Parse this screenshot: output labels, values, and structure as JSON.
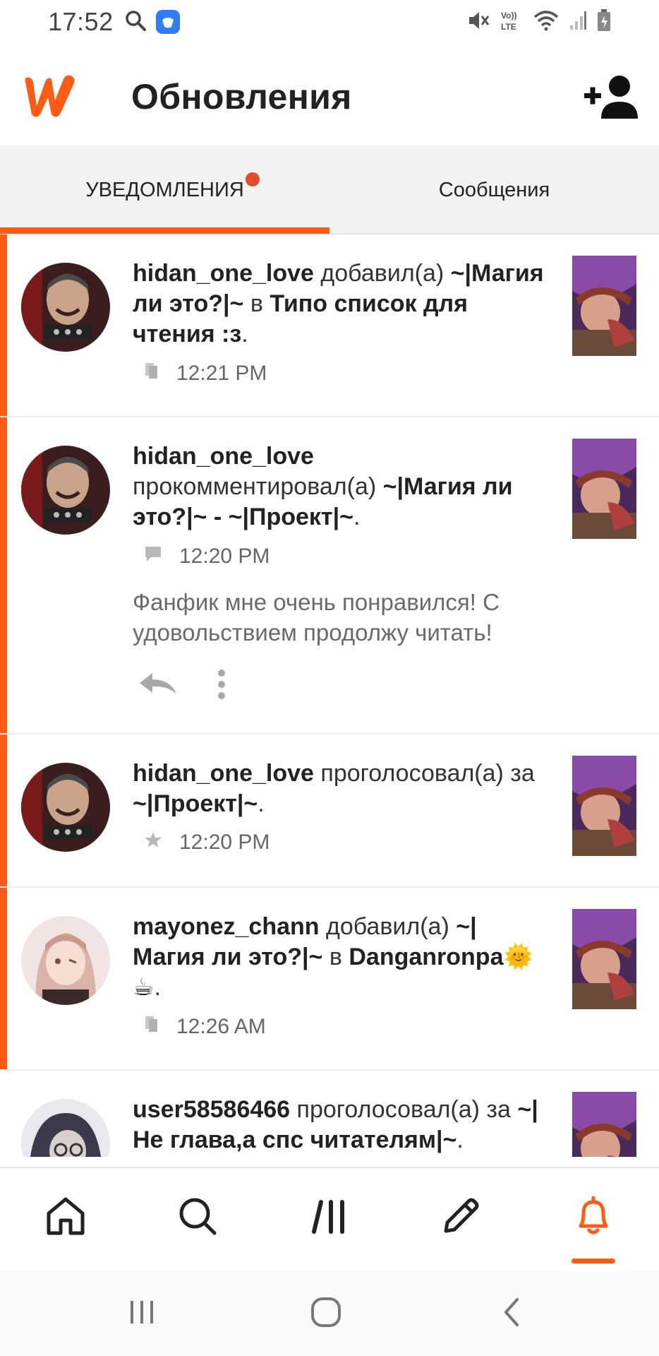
{
  "status_bar": {
    "time": "17:52",
    "icons": [
      "search-icon",
      "app-badge-icon",
      "mute-icon",
      "volte-icon",
      "wifi-icon",
      "signal-icon",
      "battery-icon"
    ]
  },
  "header": {
    "title": "Обновления",
    "logo": "wattpad-logo",
    "add_friend_icon": "add-person-icon",
    "accent": "#ff5b14"
  },
  "tabs": [
    {
      "label": "УВЕДОМЛЕНИЯ",
      "active": true,
      "has_dot": true
    },
    {
      "label": "Сообщения",
      "active": false
    }
  ],
  "notifications": [
    {
      "user": "hidan_one_love",
      "parts": [
        {
          "t": "hidan_one_love",
          "b": true
        },
        {
          "t": " добавил(а) ",
          "b": false
        },
        {
          "t": "~|Магия ли это?|~",
          "b": true
        },
        {
          "t": " в ",
          "b": false
        },
        {
          "t": "Типо список для чтения :з",
          "b": true
        },
        {
          "t": ".",
          "b": false
        }
      ],
      "icon": "library-icon",
      "time": "12:21 PM"
    },
    {
      "user": "hidan_one_love",
      "parts": [
        {
          "t": "hidan_one_love",
          "b": true
        },
        {
          "t": " прокомментировал(а) ",
          "b": false
        },
        {
          "t": "~|Магия ли это?|~ - ~|Проект|~",
          "b": true
        },
        {
          "t": ".",
          "b": false
        }
      ],
      "icon": "comment-icon",
      "time": "12:20 PM",
      "comment": "Фанфик мне очень понравился! С удовольствием продолжу читать!"
    },
    {
      "user": "hidan_one_love",
      "parts": [
        {
          "t": "hidan_one_love",
          "b": true
        },
        {
          "t": " проголосовал(а) за ",
          "b": false
        },
        {
          "t": "~|Проект|~",
          "b": true
        },
        {
          "t": ".",
          "b": false
        }
      ],
      "icon": "star-icon",
      "time": "12:20 PM"
    },
    {
      "user": "mayonez_chann",
      "parts": [
        {
          "t": "mayonez_chann",
          "b": true
        },
        {
          "t": " добавил(а) ",
          "b": false
        },
        {
          "t": "~|Магия ли это?|~",
          "b": true
        },
        {
          "t": " в ",
          "b": false
        },
        {
          "t": "Danganronpa🌞☕",
          "b": true
        },
        {
          "t": ".",
          "b": false
        }
      ],
      "icon": "library-icon",
      "time": "12:26 AM"
    },
    {
      "user": "user58586466",
      "parts": [
        {
          "t": "user58586466",
          "b": true
        },
        {
          "t": " проголосовал(а) за ",
          "b": false
        },
        {
          "t": "~|Не глава,а спс читателям|~",
          "b": true
        },
        {
          "t": ".",
          "b": false
        }
      ],
      "icon": "star-icon",
      "time": ""
    }
  ],
  "bottom_nav": [
    {
      "name": "home",
      "icon": "home-icon"
    },
    {
      "name": "search",
      "icon": "search-icon"
    },
    {
      "name": "library",
      "icon": "library-icon"
    },
    {
      "name": "write",
      "icon": "pencil-icon"
    },
    {
      "name": "notifications",
      "icon": "bell-icon",
      "active": true
    }
  ],
  "system_nav": [
    "recents-icon",
    "home-circle-icon",
    "back-icon"
  ]
}
